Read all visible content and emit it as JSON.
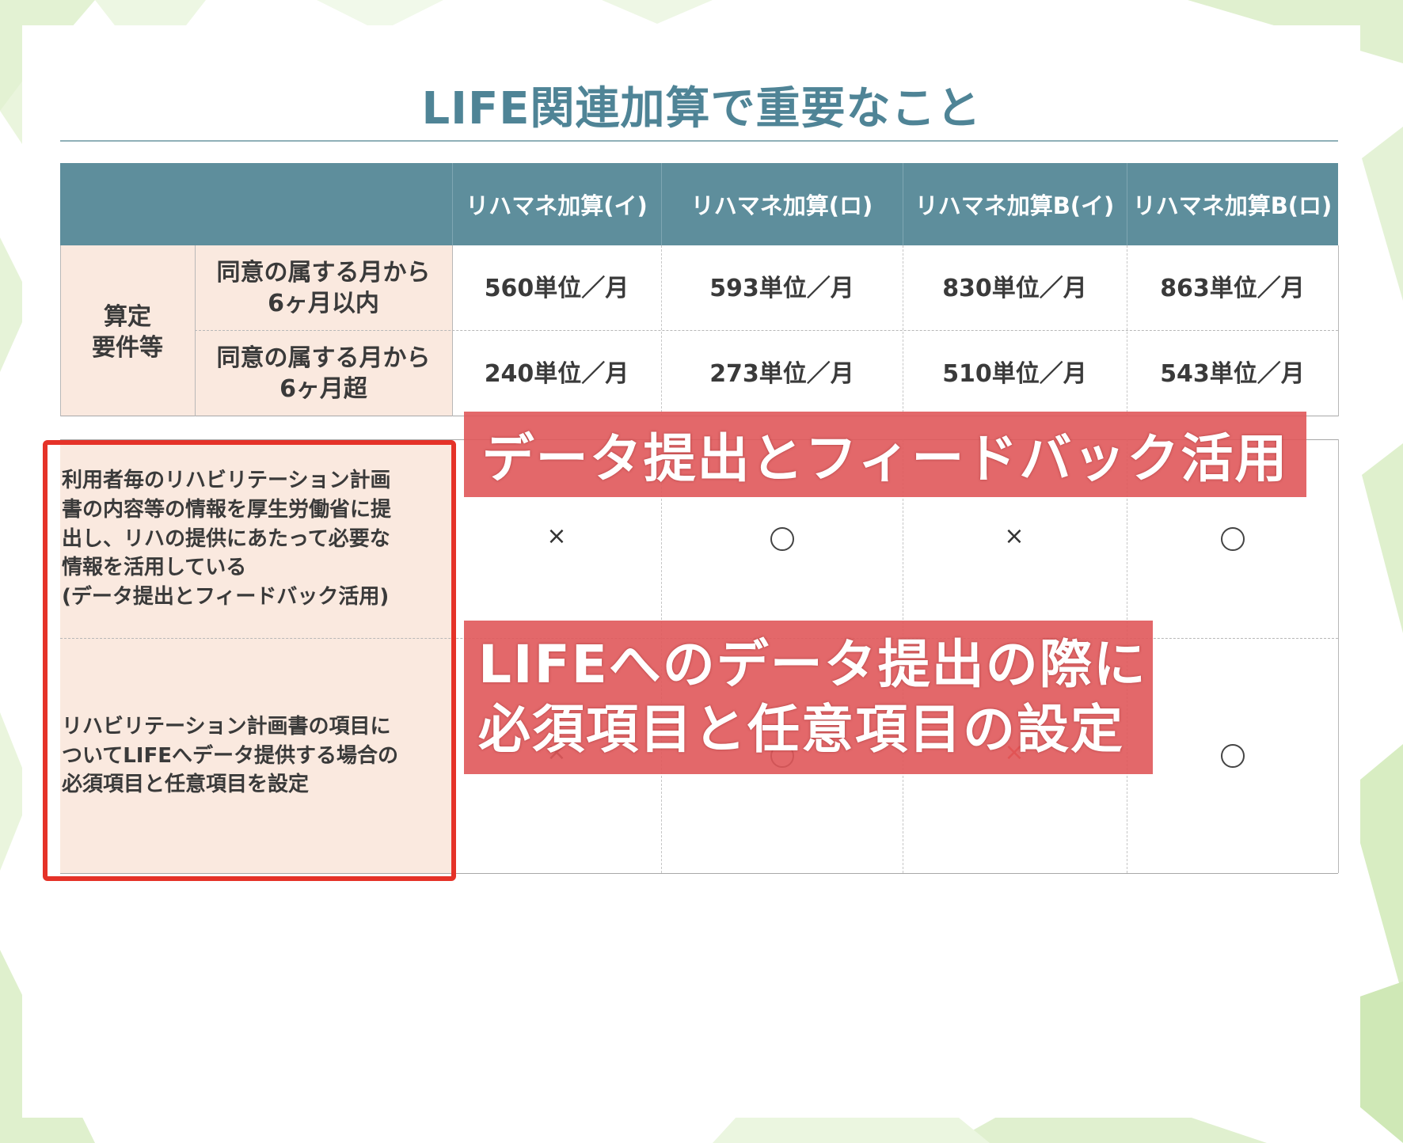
{
  "title": "LIFE関連加算で重要なこと",
  "table": {
    "headers": [
      "リハマネ加算(イ)",
      "リハマネ加算(ロ)",
      "リハマネ加算B(イ)",
      "リハマネ加算B(ロ)"
    ],
    "group_label": [
      "算定",
      "要件等"
    ],
    "rows": [
      {
        "label": [
          "同意の属する月から",
          "6ヶ月以内"
        ],
        "values": [
          "560単位／月",
          "593単位／月",
          "830単位／月",
          "863単位／月"
        ]
      },
      {
        "label": [
          "同意の属する月から",
          "6ヶ月超"
        ],
        "values": [
          "240単位／月",
          "273単位／月",
          "510単位／月",
          "543単位／月"
        ]
      }
    ],
    "requirements": [
      {
        "text": [
          "利用者毎のリハビリテーション計画",
          "書の内容等の情報を厚生労働省に提",
          "出し、リハの提供にあたって必要な",
          "情報を活用している",
          "(データ提出とフィードバック活用)"
        ],
        "marks": [
          "×",
          "○",
          "×",
          "○"
        ]
      },
      {
        "text": [
          "リハビリテーション計画書の項目に",
          "ついてLIFEへデータ提供する場合の",
          "必須項目と任意項目を設定"
        ],
        "marks": [
          "×",
          "○",
          "×",
          "○"
        ]
      }
    ]
  },
  "overlays": {
    "first": "データ提出とフィードバック活用",
    "second": [
      "LIFEへのデータ提出の際に",
      "必須項目と任意項目の設定"
    ]
  }
}
